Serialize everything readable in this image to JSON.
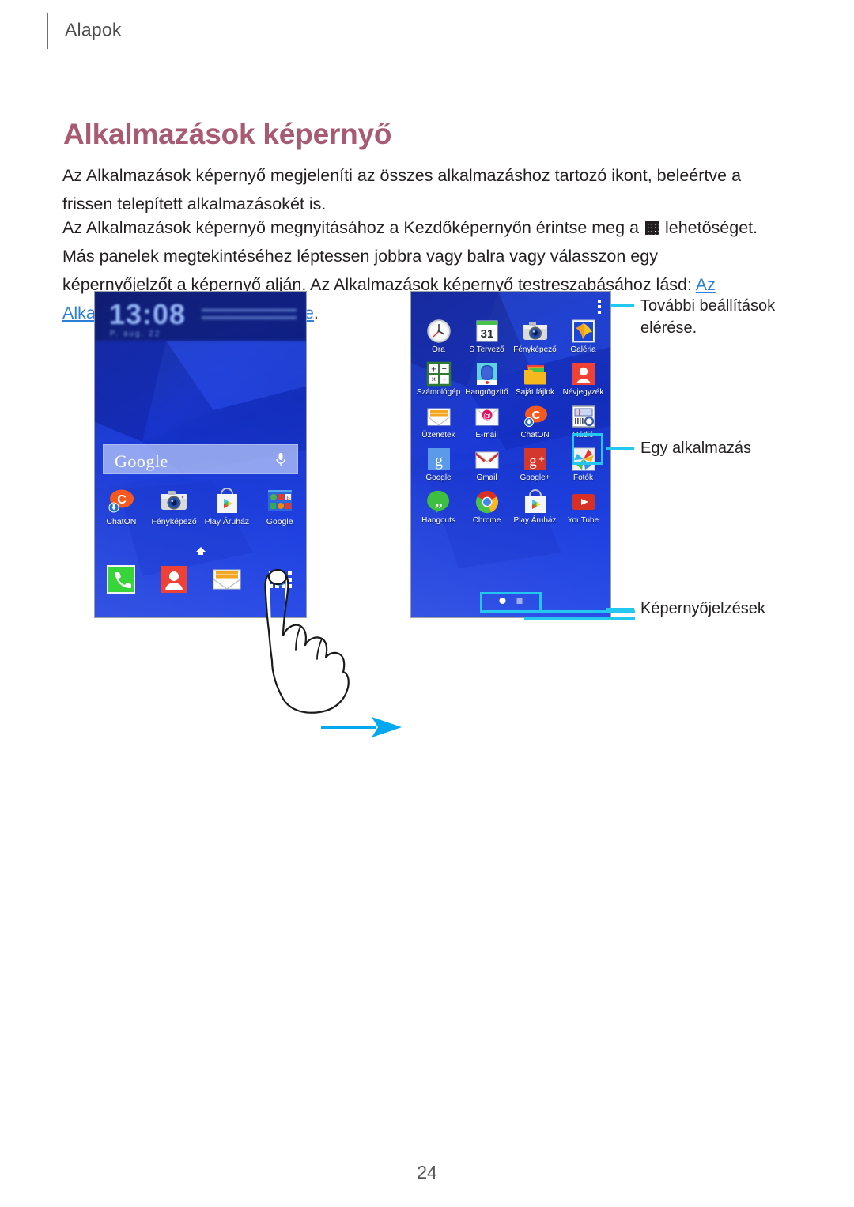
{
  "header": {
    "chapter": "Alapok"
  },
  "title": "Alkalmazások képernyő",
  "paragraphs": {
    "p1": "Az Alkalmazások képernyő megjeleníti az összes alkalmazáshoz tartozó ikont, beleértve a frissen telepített alkalmazásokét is.",
    "p2_a": "Az Alkalmazások képernyő megnyitásához a Kezdőképernyőn érintse meg a ",
    "p2_b": " lehetőséget. Más panelek megtekintéséhez léptessen jobbra vagy balra vagy válasszon egy képernyőjelzőt a képernyő alján. Az Alkalmazások képernyő testreszabásához lásd: ",
    "p2_link": "Az Alkalmazások képernyő kezelése",
    "p2_c": "."
  },
  "home_screen": {
    "clock_time": "13:08",
    "clock_date": "P. aug. 22",
    "search_widget": "Google",
    "search_mic_icon": "microphone-icon",
    "apps": [
      {
        "label": "ChatON",
        "icon": "chaton-icon"
      },
      {
        "label": "Fényképező",
        "icon": "camera-icon"
      },
      {
        "label": "Play Áruház",
        "icon": "play-store-icon"
      },
      {
        "label": "Google",
        "icon": "google-folder-icon"
      }
    ],
    "dock": [
      {
        "label": "",
        "icon": "phone-icon"
      },
      {
        "label": "",
        "icon": "contacts-icon"
      },
      {
        "label": "",
        "icon": "messages-icon"
      },
      {
        "label": "",
        "icon": "apps-grid-icon"
      }
    ],
    "home_indicator_icon": "home-icon"
  },
  "apps_screen": {
    "menu_icon": "more-options-icon",
    "apps": [
      {
        "label": "Óra",
        "icon": "clock-icon"
      },
      {
        "label": "S Tervező",
        "icon": "calendar-icon"
      },
      {
        "label": "Fényképező",
        "icon": "camera-icon"
      },
      {
        "label": "Galéria",
        "icon": "gallery-icon"
      },
      {
        "label": "Számológép",
        "icon": "calculator-icon"
      },
      {
        "label": "Hangrögzítő",
        "icon": "voice-recorder-icon"
      },
      {
        "label": "Saját fájlok",
        "icon": "my-files-icon"
      },
      {
        "label": "Névjegyzék",
        "icon": "contacts-icon"
      },
      {
        "label": "Üzenetek",
        "icon": "messages-icon"
      },
      {
        "label": "E-mail",
        "icon": "email-icon"
      },
      {
        "label": "ChatON",
        "icon": "chaton-icon"
      },
      {
        "label": "Rádió",
        "icon": "radio-icon"
      },
      {
        "label": "Google",
        "icon": "google-icon"
      },
      {
        "label": "Gmail",
        "icon": "gmail-icon"
      },
      {
        "label": "Google+",
        "icon": "google-plus-icon"
      },
      {
        "label": "Fotók",
        "icon": "photos-icon"
      },
      {
        "label": "Hangouts",
        "icon": "hangouts-icon"
      },
      {
        "label": "Chrome",
        "icon": "chrome-icon"
      },
      {
        "label": "Play Áruház",
        "icon": "play-store-icon"
      },
      {
        "label": "YouTube",
        "icon": "youtube-icon"
      }
    ],
    "page_dots": {
      "count": 2,
      "active_index": 0
    }
  },
  "callouts": [
    {
      "id": "more-settings",
      "text": "További beállítások\nelérése."
    },
    {
      "id": "single-app",
      "text": "Egy alkalmazás"
    },
    {
      "id": "screen-indicators",
      "text": "Képernyőjelzések"
    }
  ],
  "colors": {
    "title": "#a85a72",
    "link": "#2d7fd6",
    "callout": "#23c7f0",
    "arrow": "#00a8f0",
    "wallpaper": "#1f3fdc"
  },
  "page_number": "24"
}
